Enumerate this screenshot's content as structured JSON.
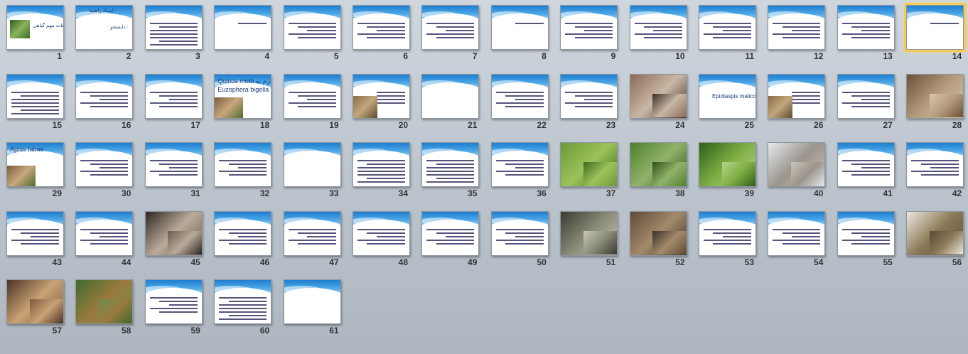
{
  "slides": [
    {
      "n": "1",
      "kind": "title-photo",
      "title": "آفات مهم گیاهی"
    },
    {
      "n": "2",
      "kind": "title-text",
      "title": "استاد راهنما :",
      "sub": "دانشجو :"
    },
    {
      "n": "3",
      "kind": "dense"
    },
    {
      "n": "4",
      "kind": "one-line"
    },
    {
      "n": "5",
      "kind": "text"
    },
    {
      "n": "6",
      "kind": "text"
    },
    {
      "n": "7",
      "kind": "text"
    },
    {
      "n": "8",
      "kind": "one-line"
    },
    {
      "n": "9",
      "kind": "text"
    },
    {
      "n": "10",
      "kind": "text"
    },
    {
      "n": "11",
      "kind": "text"
    },
    {
      "n": "12",
      "kind": "text"
    },
    {
      "n": "13",
      "kind": "text"
    },
    {
      "n": "14",
      "kind": "one-line",
      "selected": true
    },
    {
      "n": "15",
      "kind": "dense"
    },
    {
      "n": "16",
      "kind": "text"
    },
    {
      "n": "17",
      "kind": "text"
    },
    {
      "n": "18",
      "kind": "photo-title",
      "title": "Quince moth کرم به",
      "sub": "Euzophera bigella"
    },
    {
      "n": "19",
      "kind": "text"
    },
    {
      "n": "20",
      "kind": "photo-left"
    },
    {
      "n": "21",
      "kind": "empty"
    },
    {
      "n": "22",
      "kind": "text"
    },
    {
      "n": "23",
      "kind": "text"
    },
    {
      "n": "24",
      "kind": "photo",
      "colors": [
        "#8b6a55",
        "#c9b7a6",
        "#3b2c24"
      ]
    },
    {
      "n": "25",
      "kind": "title-only",
      "title": "Epidiaspis malicola"
    },
    {
      "n": "26",
      "kind": "photo-left"
    },
    {
      "n": "27",
      "kind": "text"
    },
    {
      "n": "28",
      "kind": "photo",
      "colors": [
        "#6d5036",
        "#b59b7e",
        "#d8c5ad"
      ]
    },
    {
      "n": "29",
      "kind": "photo-title",
      "title": "Aphis fabae"
    },
    {
      "n": "30",
      "kind": "text"
    },
    {
      "n": "31",
      "kind": "text"
    },
    {
      "n": "32",
      "kind": "text"
    },
    {
      "n": "33",
      "kind": "empty"
    },
    {
      "n": "34",
      "kind": "dense"
    },
    {
      "n": "35",
      "kind": "dense"
    },
    {
      "n": "36",
      "kind": "text"
    },
    {
      "n": "37",
      "kind": "photo",
      "colors": [
        "#6a9a38",
        "#9cc25a",
        "#3d6b1e"
      ]
    },
    {
      "n": "38",
      "kind": "photo",
      "colors": [
        "#4f7f2d",
        "#8fb36a",
        "#2f4f1b"
      ]
    },
    {
      "n": "39",
      "kind": "photo",
      "colors": [
        "#2e5f18",
        "#7fae45",
        "#b5d58a"
      ]
    },
    {
      "n": "40",
      "kind": "photo",
      "colors": [
        "#e7e9ec",
        "#9a948c",
        "#c9c3b8"
      ]
    },
    {
      "n": "41",
      "kind": "text"
    },
    {
      "n": "42",
      "kind": "text"
    },
    {
      "n": "43",
      "kind": "text"
    },
    {
      "n": "44",
      "kind": "text"
    },
    {
      "n": "45",
      "kind": "photo",
      "colors": [
        "#2d2620",
        "#b9aa9a",
        "#6b5b4d"
      ]
    },
    {
      "n": "46",
      "kind": "text"
    },
    {
      "n": "47",
      "kind": "text"
    },
    {
      "n": "48",
      "kind": "text"
    },
    {
      "n": "49",
      "kind": "text"
    },
    {
      "n": "50",
      "kind": "text"
    },
    {
      "n": "51",
      "kind": "photo",
      "colors": [
        "#3a3a30",
        "#8a8a78",
        "#c9c8b5"
      ]
    },
    {
      "n": "52",
      "kind": "photo",
      "colors": [
        "#5e4a38",
        "#a38a6a",
        "#37302a"
      ]
    },
    {
      "n": "53",
      "kind": "text"
    },
    {
      "n": "54",
      "kind": "text"
    },
    {
      "n": "55",
      "kind": "text"
    },
    {
      "n": "56",
      "kind": "photo",
      "colors": [
        "#ece8de",
        "#8b7a57",
        "#5a4a33"
      ]
    },
    {
      "n": "57",
      "kind": "photo",
      "colors": [
        "#4a3324",
        "#c9a274",
        "#7b5a3d"
      ]
    },
    {
      "n": "58",
      "kind": "photo",
      "colors": [
        "#3f6a2e",
        "#9a7a3e",
        "#6e8d4c"
      ]
    },
    {
      "n": "59",
      "kind": "text"
    },
    {
      "n": "60",
      "kind": "dense"
    },
    {
      "n": "61",
      "kind": "empty"
    }
  ]
}
